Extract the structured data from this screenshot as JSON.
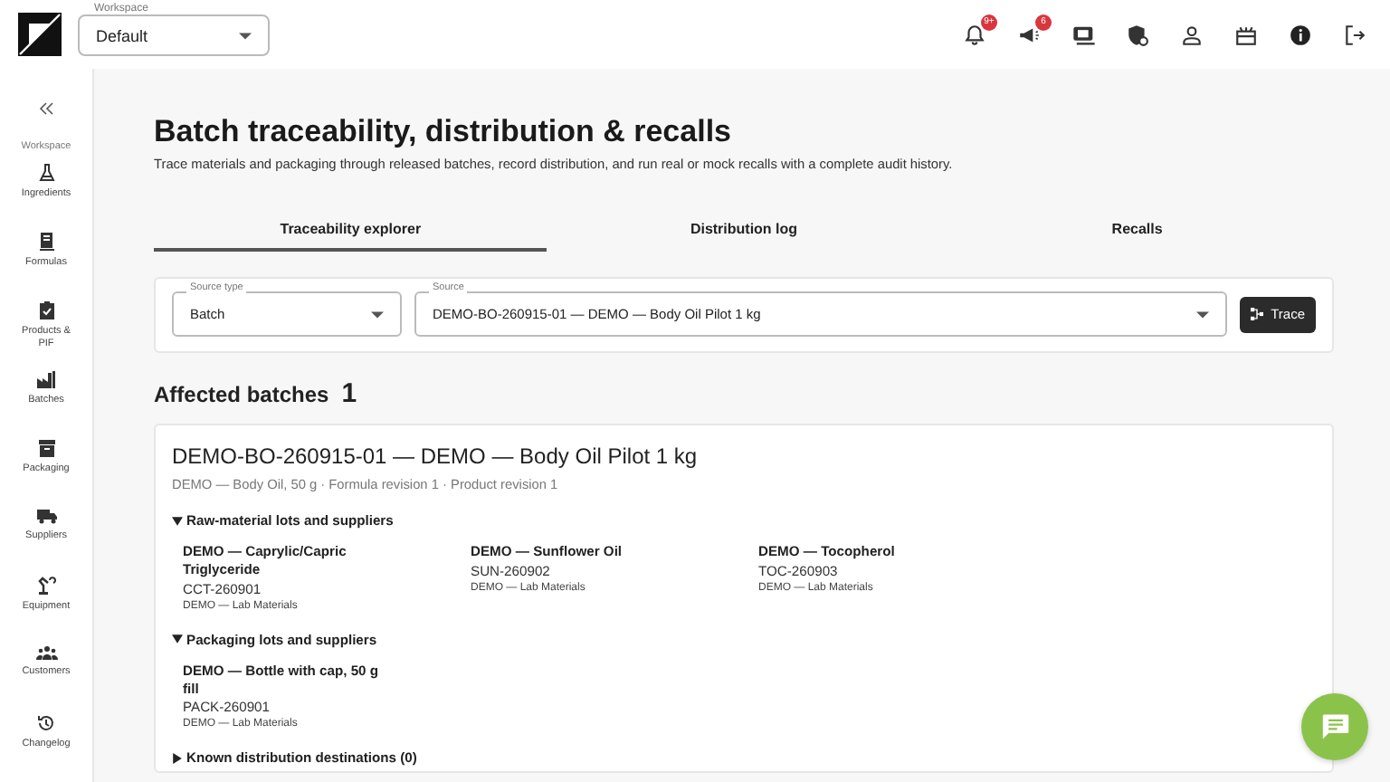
{
  "header": {
    "workspace": {
      "label": "Workspace",
      "value": "Default"
    },
    "actions": [
      {
        "kind": "bell",
        "badge": "9+"
      },
      {
        "kind": "megaphone",
        "badge": "6"
      },
      {
        "kind": "screen"
      },
      {
        "kind": "shield"
      },
      {
        "kind": "user"
      },
      {
        "kind": "gift"
      },
      {
        "kind": "info"
      },
      {
        "kind": "logout"
      }
    ]
  },
  "sidebar": {
    "section": "Workspace",
    "items": [
      {
        "kind": "flask",
        "label": "Ingredients"
      },
      {
        "kind": "document",
        "label": "Formulas"
      },
      {
        "kind": "clipboard",
        "label": "Products & PIF"
      },
      {
        "kind": "factory",
        "label": "Batches"
      },
      {
        "kind": "archive",
        "label": "Packaging"
      },
      {
        "kind": "truck",
        "label": "Suppliers"
      },
      {
        "kind": "robot",
        "label": "Equipment"
      },
      {
        "kind": "people",
        "label": "Customers"
      },
      {
        "kind": "history",
        "label": "Changelog"
      }
    ]
  },
  "page": {
    "title": "Batch traceability, distribution & recalls",
    "subtitle": "Trace materials and packaging through released batches, record distribution, and run real or mock recalls with a complete audit history."
  },
  "tabs": [
    {
      "label": "Traceability explorer",
      "selected": true
    },
    {
      "label": "Distribution log",
      "selected": false
    },
    {
      "label": "Recalls",
      "selected": false
    }
  ],
  "filters": {
    "source_type": {
      "label": "Source type",
      "value": "Batch"
    },
    "source": {
      "label": "Source",
      "value": "DEMO-BO-260915-01 — DEMO — Body Oil Pilot 1 kg"
    },
    "button": "Trace"
  },
  "affected": {
    "title": "Affected batches",
    "count": "1"
  },
  "batch": {
    "title": "DEMO-BO-260915-01 — DEMO — Body Oil Pilot 1 kg",
    "meta": "DEMO — Body Oil, 50 g · Formula revision 1 · Product revision 1",
    "sections": [
      {
        "title": "Raw-material lots and suppliers",
        "expanded": true,
        "items": [
          {
            "name": "DEMO — Caprylic/Capric Triglyceride",
            "lot": "CCT-260901",
            "supplier": "DEMO — Lab Materials"
          },
          {
            "name": "DEMO — Sunflower Oil",
            "lot": "SUN-260902",
            "supplier": "DEMO — Lab Materials"
          },
          {
            "name": "DEMO — Tocopherol",
            "lot": "TOC-260903",
            "supplier": "DEMO — Lab Materials"
          }
        ]
      },
      {
        "title": "Packaging lots and suppliers",
        "expanded": true,
        "items": [
          {
            "name": "DEMO — Bottle with cap, 50 g fill",
            "lot": "PACK-260901",
            "supplier": "DEMO — Lab Materials"
          }
        ]
      },
      {
        "title": "Known distribution destinations (0)",
        "expanded": false
      }
    ]
  }
}
